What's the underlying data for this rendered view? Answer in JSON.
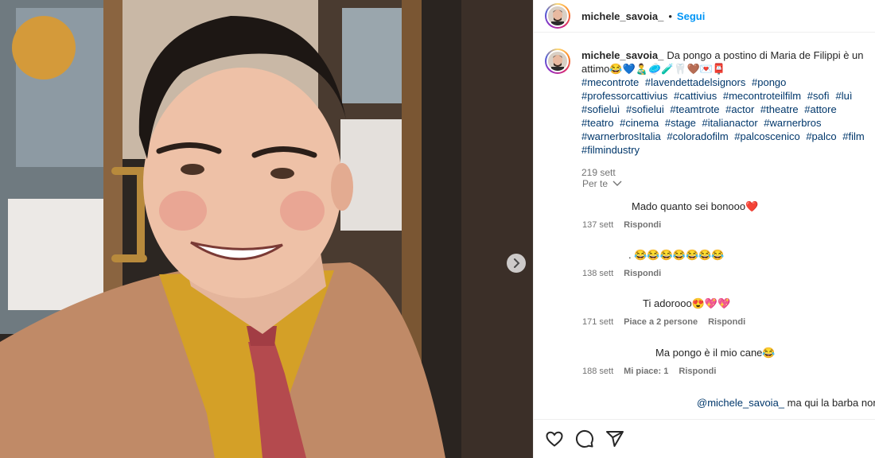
{
  "header": {
    "username": "michele_savoia_",
    "separator": "•",
    "follow_label": "Segui"
  },
  "caption": {
    "username": "michele_savoia_",
    "text": "Da pongo a postino di Maria de Filippi è un attimo😂💙👨‍🍼🥏🧪🦷🤎💌📮",
    "hashtags": [
      "#mecontrote",
      "#lavendettadelsignors",
      "#pongo",
      "#professorcattivius",
      "#cattivius",
      "#mecontroteilfilm",
      "#sofì",
      "#luì",
      "#sofieluì",
      "#sofielui",
      "#teamtrote",
      "#actor",
      "#theatre",
      "#attore",
      "#teatro",
      "#cinema",
      "#stage",
      "#italianactor",
      "#warnerbros",
      "#warnerbrosItalia",
      "#coloradofilm",
      "#palcoscenico",
      "#palco",
      "#film",
      "#filmindustry"
    ],
    "time": "219 sett"
  },
  "sorter": {
    "label": "Per te",
    "icon": "chevron-down-icon"
  },
  "comments": [
    {
      "text": "Mado quanto sei bonooo❤️",
      "time": "137 sett",
      "likes": "",
      "reply": "Rispondi"
    },
    {
      "text": ". 😂😂😂😂😂😂😂",
      "time": "138 sett",
      "likes": "",
      "reply": "Rispondi"
    },
    {
      "text": "Ti adorooo😍💖💖",
      "time": "171 sett",
      "likes": "Piace a 2 persone",
      "reply": "Rispondi"
    },
    {
      "text": "Ma pongo è il mio cane😂",
      "time": "188 sett",
      "likes": "Mi piace: 1",
      "reply": "Rispondi"
    }
  ],
  "partial_comment": {
    "mention": "@michele_savoia_",
    "text": "ma qui la barba non"
  },
  "actions": {
    "like_icon": "heart-icon",
    "comment_icon": "comment-icon",
    "share_icon": "share-icon"
  },
  "media": {
    "next_icon": "chevron-right-icon"
  },
  "colors": {
    "link": "#0095f6",
    "hashtag": "#00376b",
    "muted": "#737373"
  }
}
